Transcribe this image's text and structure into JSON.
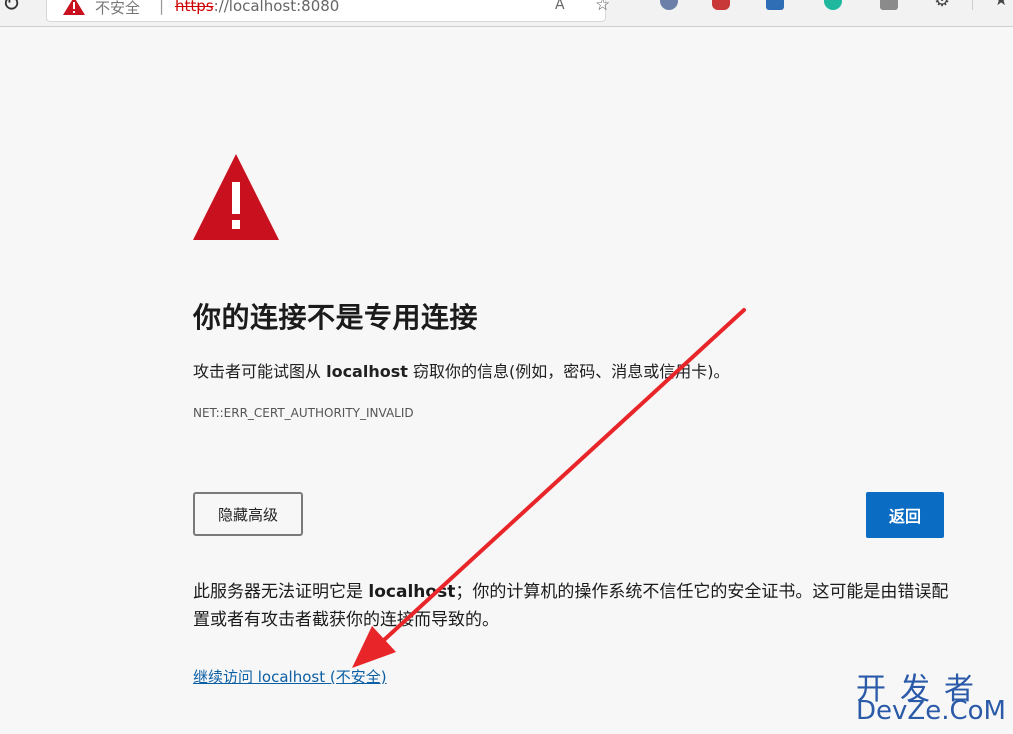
{
  "browser": {
    "not_secure_label": "不安全",
    "separator": "|",
    "url_scheme": "https",
    "url_rest": "://localhost:8080",
    "read_aloud": "Aᴬ",
    "extensions": [
      "profile-extension",
      "du-extension",
      "translate-extension",
      "m-extension",
      "reader-extension",
      "puzzle-extension",
      "favorites-extension"
    ]
  },
  "page": {
    "title": "你的连接不是专用连接",
    "desc_prefix": "攻击者可能试图从 ",
    "desc_host": "localhost",
    "desc_suffix": " 窃取你的信息(例如，密码、消息或信用卡)。",
    "error_code": "NET::ERR_CERT_AUTHORITY_INVALID",
    "advanced_button": "隐藏高级",
    "back_button": "返回",
    "details_prefix": "此服务器无法证明它是 ",
    "details_host": "localhost",
    "details_suffix": "；你的计算机的操作系统不信任它的安全证书。这可能是由错误配置或者有攻击者截获你的连接而导致的。",
    "proceed_link": "继续访问 localhost (不安全)"
  },
  "watermark": {
    "line1": "开发者",
    "line2": "DevZe.CoM"
  },
  "colors": {
    "warning_red": "#c8101e",
    "primary_blue": "#0b6cc4",
    "link_blue": "#0b5fa5",
    "annotation_arrow": "#e8262a"
  }
}
